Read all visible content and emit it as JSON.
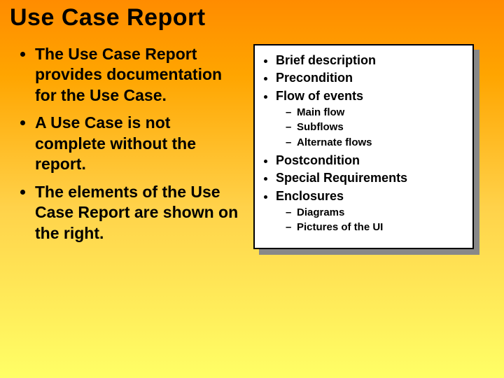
{
  "title": "Use Case Report",
  "left": {
    "items": [
      "The Use Case Report provides documentation for the Use Case.",
      "A Use Case is not complete without the report.",
      "The elements of the Use Case Report are shown on the right."
    ]
  },
  "right": {
    "items": [
      {
        "label": "Brief description"
      },
      {
        "label": "Precondition"
      },
      {
        "label": "Flow of events",
        "sub": [
          "Main flow",
          "Subflows",
          "Alternate flows"
        ]
      },
      {
        "label": "Postcondition"
      },
      {
        "label": "Special Requirements"
      },
      {
        "label": "Enclosures",
        "sub": [
          "Diagrams",
          "Pictures of the UI"
        ]
      }
    ]
  }
}
